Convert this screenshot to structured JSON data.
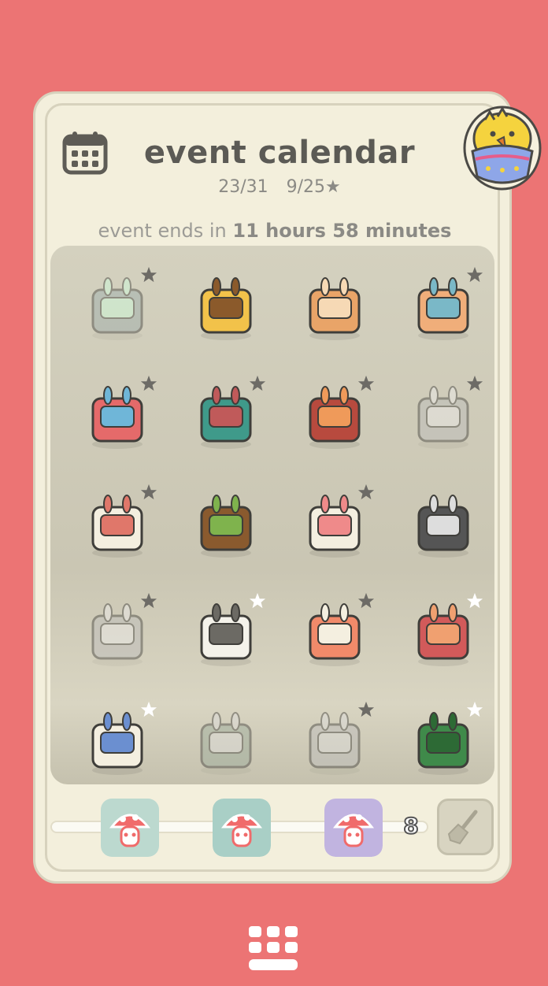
{
  "header": {
    "title": "event calendar",
    "progress_days": "23/31",
    "progress_stars": "9/25★",
    "ends_prefix": "event ends in",
    "ends_value": "11 hours 58 minutes"
  },
  "grid": {
    "items": [
      {
        "name": "plant-tray",
        "star": "dark",
        "faded": true
      },
      {
        "name": "chick-backpack",
        "star": "none",
        "faded": false
      },
      {
        "name": "bunny-rug-scroll",
        "star": "none",
        "faded": false
      },
      {
        "name": "bunny-table",
        "star": "dark",
        "faded": false
      },
      {
        "name": "folding-screen",
        "star": "dark",
        "faded": false
      },
      {
        "name": "bunny-cabinet",
        "star": "dark",
        "faded": false
      },
      {
        "name": "rabbit-hutch",
        "star": "dark",
        "faded": false
      },
      {
        "name": "bunny-teapot",
        "star": "dark",
        "faded": true
      },
      {
        "name": "bunny-bed",
        "star": "dark",
        "faded": false
      },
      {
        "name": "grass-box",
        "star": "none",
        "faded": false
      },
      {
        "name": "bunny-paw-glove",
        "star": "dark",
        "faded": false
      },
      {
        "name": "bunny-cassette",
        "star": "none",
        "faded": false
      },
      {
        "name": "bunny-fireplace",
        "star": "dark",
        "faded": true
      },
      {
        "name": "egg-stand",
        "star": "white",
        "faded": false
      },
      {
        "name": "bunny-stool",
        "star": "dark",
        "faded": false
      },
      {
        "name": "bunny-chest",
        "star": "white",
        "faded": false
      },
      {
        "name": "bunny-bookshelf",
        "star": "white",
        "faded": false
      },
      {
        "name": "lily-plant",
        "star": "none",
        "faded": true
      },
      {
        "name": "crystal-egg",
        "star": "dark",
        "faded": true
      },
      {
        "name": "bunny-topiary",
        "star": "white",
        "faded": false
      }
    ]
  },
  "rewards": {
    "count": "8",
    "items": [
      "mushroom-reward-1",
      "mushroom-reward-2",
      "mushroom-reward-3"
    ]
  },
  "icons": {
    "calendar": "calendar-icon",
    "avatar": "chick-in-egg-icon",
    "broom": "broom-icon",
    "menu": "keyboard-menu-icon"
  },
  "colors": {
    "background": "#ec7474",
    "card": "#f3efdc",
    "grid": "#cfcbb8",
    "text": "#5b5a55"
  }
}
